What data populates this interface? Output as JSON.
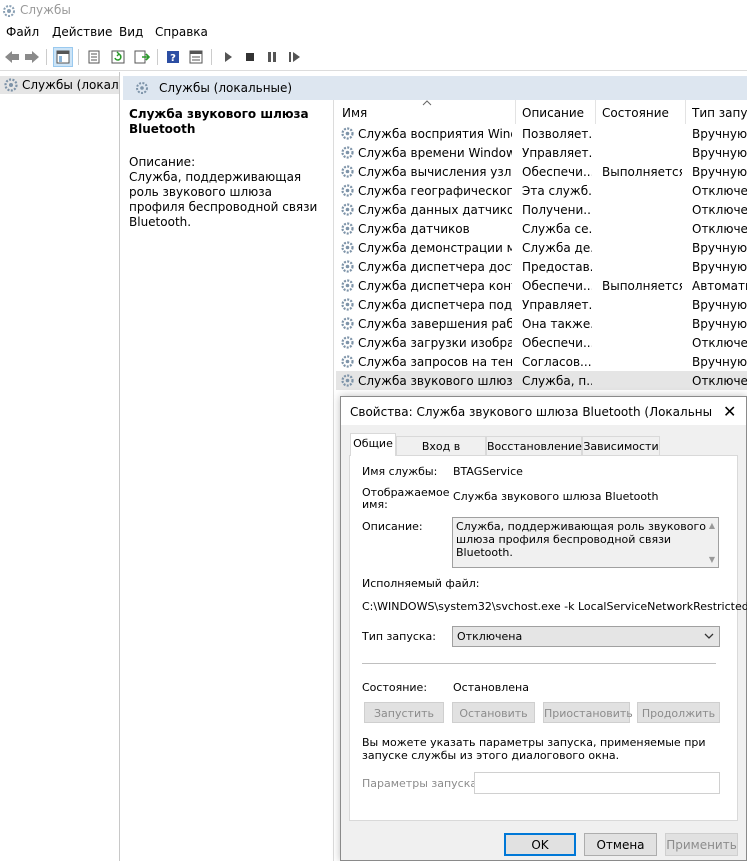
{
  "window": {
    "title": "Службы"
  },
  "menu": [
    "Файл",
    "Действие",
    "Вид",
    "Справка"
  ],
  "tree": {
    "root_label": "Службы (локальные)"
  },
  "pane": {
    "header": "Службы (локальные)"
  },
  "description": {
    "service_title": "Служба звукового шлюза Bluetooth",
    "desc_label": "Описание:",
    "desc_text": "Служба, поддерживающая роль звукового шлюза профиля беспроводной связи Bluetooth."
  },
  "columns": [
    "Имя",
    "Описание",
    "Состояние",
    "Тип запуска"
  ],
  "services": [
    {
      "name": "Служба восприятия Windows",
      "desc": "Позволяет...",
      "state": "",
      "startup": "Вручную (активировать запуск)"
    },
    {
      "name": "Служба времени Windows",
      "desc": "Управляет...",
      "state": "",
      "startup": "Вручную (активировать запуск)"
    },
    {
      "name": "Служба вычисления узлов",
      "desc": "Обеспечи...",
      "state": "Выполняется",
      "startup": "Вручную (активировать запуск)"
    },
    {
      "name": "Служба географического положения",
      "desc": "Эта служб...",
      "state": "",
      "startup": "Отключена"
    },
    {
      "name": "Служба данных датчиков",
      "desc": "Получени...",
      "state": "",
      "startup": "Отключена"
    },
    {
      "name": "Служба датчиков",
      "desc": "Служба се...",
      "state": "",
      "startup": "Отключена"
    },
    {
      "name": "Служба демонстрации магазина",
      "desc": "Служба де...",
      "state": "",
      "startup": "Вручную"
    },
    {
      "name": "Служба диспетчера доступа",
      "desc": "Предостав...",
      "state": "",
      "startup": "Вручную"
    },
    {
      "name": "Служба диспетчера контейнеров",
      "desc": "Обеспечи...",
      "state": "Выполняется",
      "startup": "Автоматически"
    },
    {
      "name": "Служба диспетчера подключений",
      "desc": "Управляет...",
      "state": "",
      "startup": "Вручную (активировать запуск)"
    },
    {
      "name": "Служба завершения работы",
      "desc": "Она также...",
      "state": "",
      "startup": "Вручную (активировать запуск)"
    },
    {
      "name": "Служба загрузки изображений",
      "desc": "Обеспечи...",
      "state": "",
      "startup": "Отключена"
    },
    {
      "name": "Служба запросов на теневое",
      "desc": "Согласов...",
      "state": "",
      "startup": "Вручную (активировать запуск)"
    },
    {
      "name": "Служба звукового шлюза Bluetooth",
      "desc": "Служба, п...",
      "state": "",
      "startup": "Отключена"
    }
  ],
  "dialog": {
    "title": "Свойства: Служба звукового шлюза Bluetooth (Локальный компьютер)",
    "tabs": [
      "Общие",
      "Вход в систему",
      "Восстановление",
      "Зависимости"
    ],
    "service_name_label": "Имя службы:",
    "service_name": "BTAGService",
    "display_name_label": "Отображаемое имя:",
    "display_name": "Служба звукового шлюза Bluetooth",
    "description_label": "Описание:",
    "description": "Служба, поддерживающая роль звукового шлюза профиля беспроводной связи Bluetooth.",
    "exe_label": "Исполняемый файл:",
    "exe_path": "C:\\WINDOWS\\system32\\svchost.exe -k LocalServiceNetworkRestricted",
    "startup_label": "Тип запуска:",
    "startup_value": "Отключена",
    "status_label": "Состояние:",
    "status_value": "Остановлена",
    "btn_start": "Запустить",
    "btn_stop": "Остановить",
    "btn_pause": "Приостановить",
    "btn_resume": "Продолжить",
    "hint": "Вы можете указать параметры запуска, применяемые при запуске службы из этого диалогового окна.",
    "params_label": "Параметры запуска:",
    "btn_ok": "OK",
    "btn_cancel": "Отмена",
    "btn_apply": "Применить"
  }
}
